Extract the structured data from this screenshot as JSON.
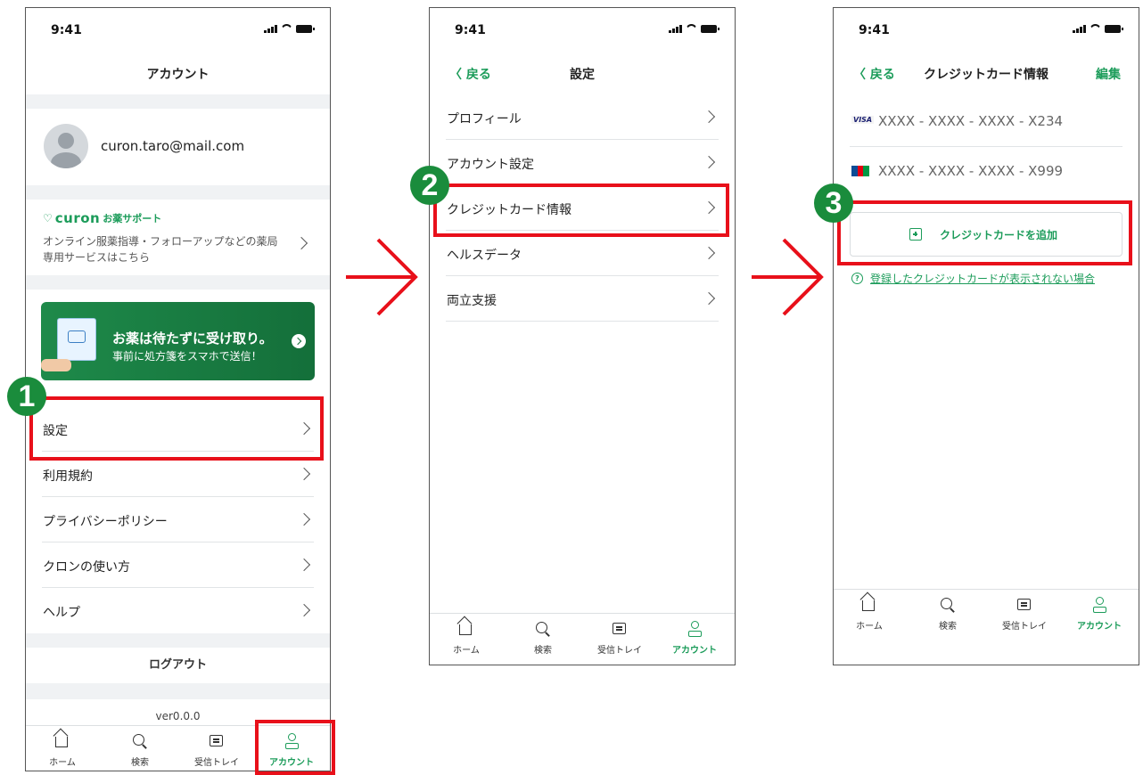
{
  "status": {
    "time": "9:41"
  },
  "screen1": {
    "title": "アカウント",
    "email": "curon.taro@mail.com",
    "support": {
      "brand": "curon",
      "brand_suffix": "お薬サポート",
      "description": "オンライン服薬指導・フォローアップなどの薬局専用サービスはこちら"
    },
    "banner": {
      "headline": "お薬は待たずに受け取り。",
      "subline": "事前に処方箋をスマホで送信！"
    },
    "menu": [
      {
        "label": "設定"
      },
      {
        "label": "利用規約"
      },
      {
        "label": "プライバシーポリシー"
      },
      {
        "label": "クロンの使い方"
      },
      {
        "label": "ヘルプ"
      }
    ],
    "logout": "ログアウト",
    "version": "ver0.0.0"
  },
  "screen2": {
    "back": "戻る",
    "title": "設定",
    "menu": [
      {
        "label": "プロフィール"
      },
      {
        "label": "アカウント設定"
      },
      {
        "label": "クレジットカード情報"
      },
      {
        "label": "ヘルスデータ"
      },
      {
        "label": "両立支援"
      }
    ]
  },
  "screen3": {
    "back": "戻る",
    "title": "クレジットカード情報",
    "edit": "編集",
    "cards": [
      {
        "brand": "VISA",
        "number": "XXXX - XXXX - XXXX - X234"
      },
      {
        "brand": "JCB",
        "number": "XXXX - XXXX - XXXX - X999"
      }
    ],
    "add_card": "クレジットカードを追加",
    "help_link": "登録したクレジットカードが表示されない場合"
  },
  "tabbar": {
    "home": "ホーム",
    "search": "検索",
    "inbox": "受信トレイ",
    "account": "アカウント"
  },
  "steps": [
    "1",
    "2",
    "3"
  ],
  "colors": {
    "accent": "#1c9c5a",
    "highlight": "#e8101a",
    "badge": "#1a8c3c",
    "arrow": "#e8101a"
  }
}
